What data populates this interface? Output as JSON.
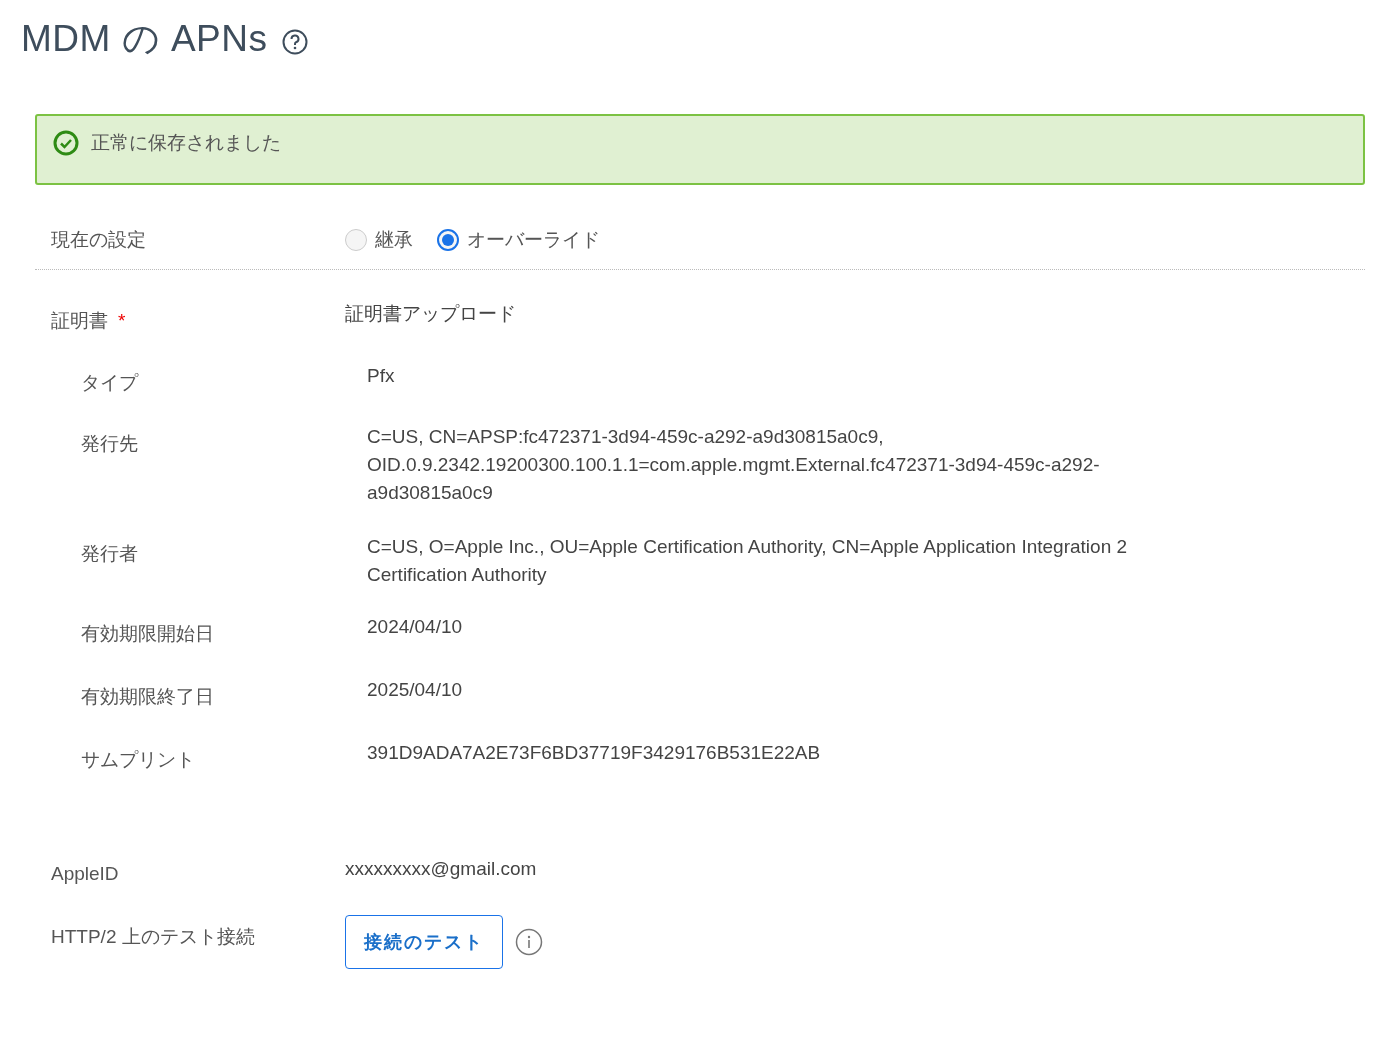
{
  "title": "MDM の APNs",
  "alert": {
    "kind": "success",
    "message": "正常に保存されました"
  },
  "current_setting": {
    "label": "現在の設定",
    "options": [
      {
        "label": "継承",
        "selected": false
      },
      {
        "label": "オーバーライド",
        "selected": true
      }
    ]
  },
  "certificate": {
    "label": "証明書",
    "required": true,
    "required_mark": "*",
    "value": "証明書アップロード",
    "fields": [
      {
        "label": "タイプ",
        "lines": [
          "Pfx"
        ]
      },
      {
        "label": "発行先",
        "lines": [
          "C=US, CN=APSP:fc472371-3d94-459c-a292-a9d30815a0c9,",
          "OID.0.9.2342.19200300.100.1.1=com.apple.mgmt.External.fc472371-3d94-459c-a292-",
          "a9d30815a0c9"
        ]
      },
      {
        "label": "発行者",
        "lines": [
          "C=US, O=Apple Inc., OU=Apple Certification Authority, CN=Apple Application Integration 2",
          "Certification Authority"
        ]
      },
      {
        "label": "有効期限開始日",
        "lines": [
          "2024/04/10"
        ]
      },
      {
        "label": "有効期限終了日",
        "lines": [
          "2025/04/10"
        ]
      },
      {
        "label": "サムプリント",
        "lines": [
          "391D9ADA7A2E73F6BD37719F3429176B531E22AB"
        ]
      }
    ]
  },
  "apple_id": {
    "label": "AppleID",
    "value": "xxxxxxxxx@gmail.com"
  },
  "test_connection": {
    "label": "HTTP/2 上のテスト接続",
    "button": "接続のテスト"
  }
}
